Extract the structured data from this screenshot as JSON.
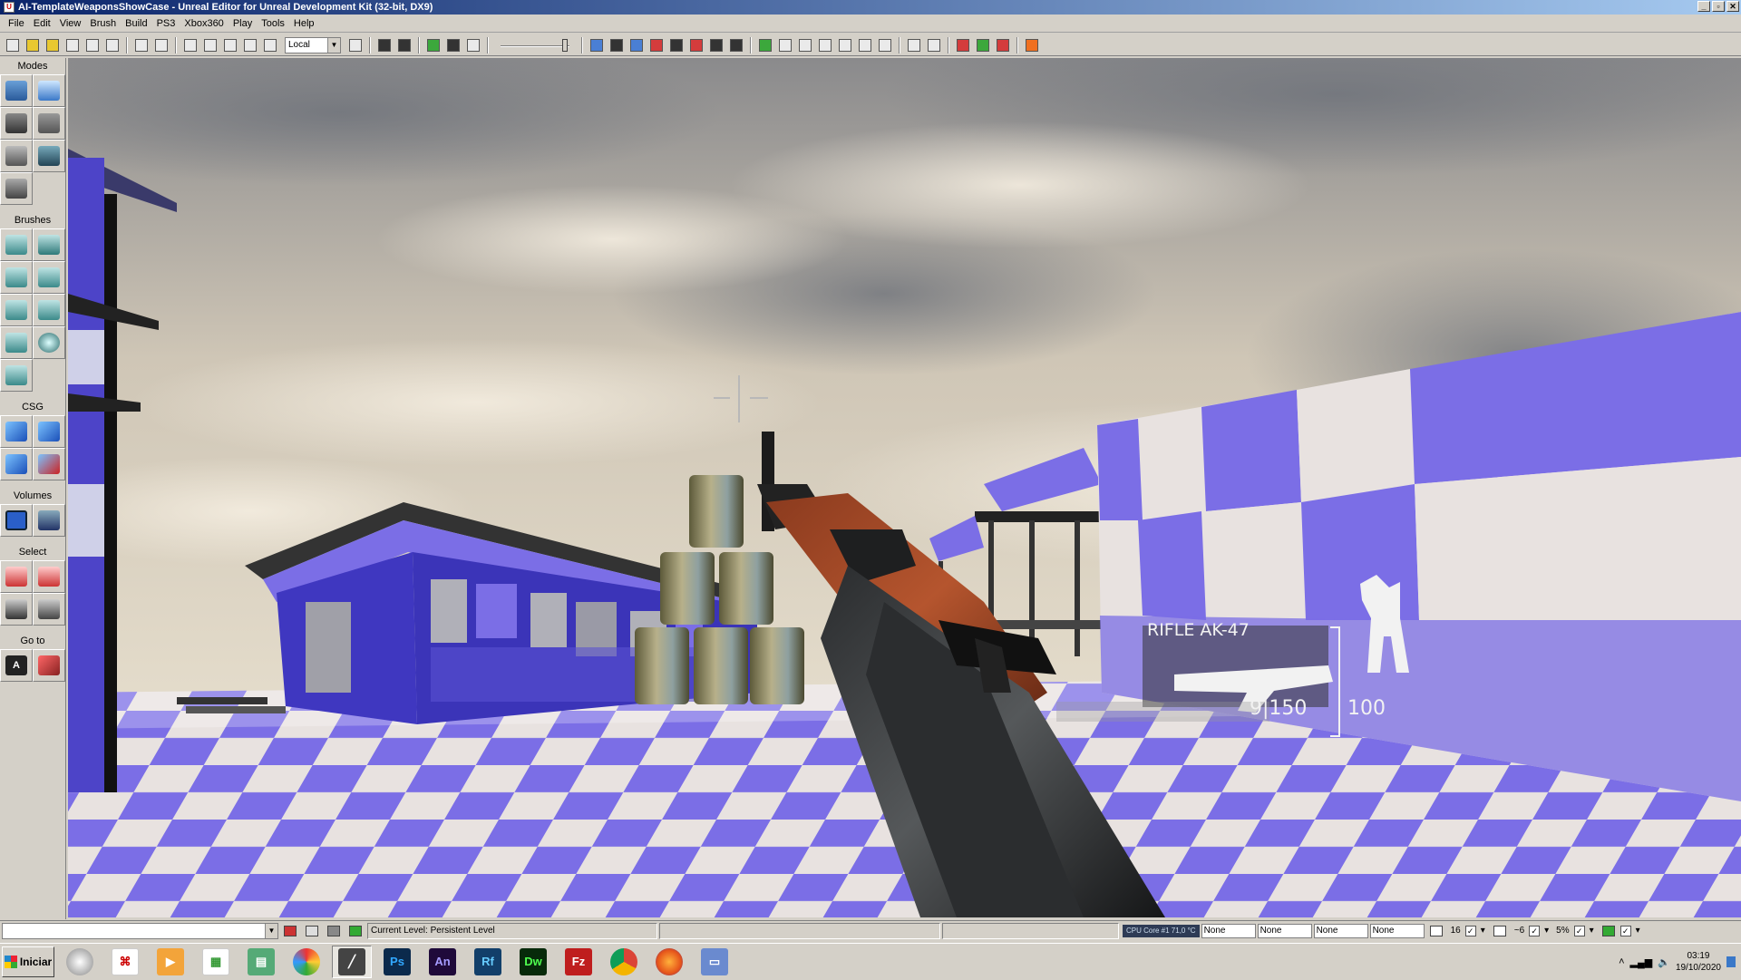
{
  "window": {
    "title": "AI-TemplateWeaponsShowCase - Unreal Editor for Unreal Development Kit (32-bit, DX9)"
  },
  "menu": [
    "File",
    "Edit",
    "View",
    "Brush",
    "Build",
    "PS3",
    "Xbox360",
    "Play",
    "Tools",
    "Help"
  ],
  "toolbar": {
    "coordinate_system": "Local"
  },
  "left_panel": {
    "modes": "Modes",
    "brushes": "Brushes",
    "csg": "CSG",
    "volumes": "Volumes",
    "select": "Select",
    "goto": "Go to"
  },
  "viewport": {
    "hud": {
      "weapon_name": "RIFLE AK-47",
      "ammo": "9|150",
      "health": "100"
    }
  },
  "status": {
    "current_level": "Current Level:  Persistent Level",
    "cpu": "CPU Core #1    71,0 °C",
    "none_1": "None",
    "none_2": "None",
    "none_3": "None",
    "none_4": "None",
    "grid_size": "16",
    "rotation_snap": "~6",
    "scale_snap": "5%"
  },
  "taskbar": {
    "start": "Iniciar",
    "apps": {
      "ps": "Ps",
      "an": "An",
      "rf": "Rf",
      "dw": "Dw",
      "fz": "Fz"
    },
    "time": "03:19",
    "date": "19/10/2020"
  },
  "colors": {
    "accent_purple": "#6b5ee0",
    "titlebar": "#0a246a"
  }
}
